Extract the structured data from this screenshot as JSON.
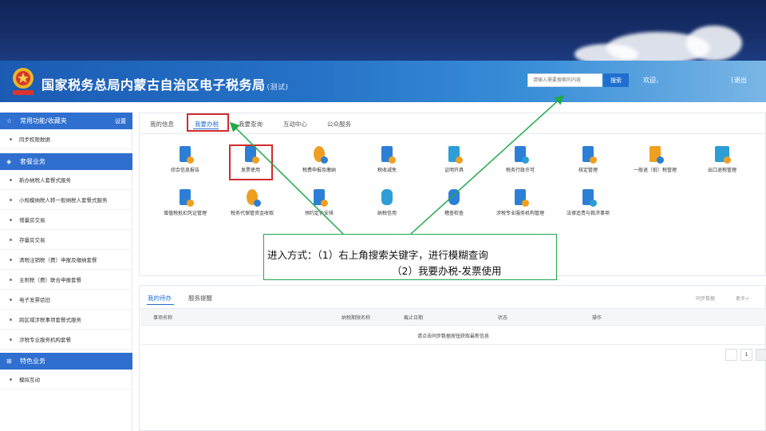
{
  "header": {
    "site_title": "国家税务总局内蒙古自治区电子税务局",
    "site_tag": "(测试)",
    "search_placeholder": "请输入需要搜索的内容",
    "search_button": "搜索",
    "welcome": "欢迎，",
    "separator": "|",
    "logout": "退出"
  },
  "sidebar": {
    "common": {
      "label": "常用功能/收藏夹",
      "setting": "设置"
    },
    "common_items": [
      "同步权限数据"
    ],
    "package": {
      "label": "套餐业务"
    },
    "package_items": [
      "新办纳税人套餐式服务",
      "小规模纳税人转一般纳税人套餐式服务",
      "增量房交易",
      "存量房交易",
      "清税注销税（费）申报及缴纳套餐",
      "主附税（费）联合申报套餐",
      "电子发票验旧",
      "跨区域涉税事项套餐式服务",
      "涉税专业服务机构套餐"
    ],
    "special": {
      "label": "特色业务"
    },
    "special_items": [
      "模拟互动"
    ]
  },
  "tabs": [
    "我的信息",
    "我要办税",
    "我要查询",
    "互动中心",
    "公众服务"
  ],
  "services_row1": [
    {
      "label": "综合信息报告",
      "icon": "report-icon",
      "color": "#2d7fd6"
    },
    {
      "label": "发票使用",
      "icon": "invoice-icon",
      "color": "#2d7fd6"
    },
    {
      "label": "税费申报及缴纳",
      "icon": "tax-declare-icon",
      "color": "#f0a020"
    },
    {
      "label": "税收减免",
      "icon": "tax-relief-icon",
      "color": "#2d7fd6"
    },
    {
      "label": "证明开具",
      "icon": "certificate-icon",
      "color": "#2d9ed6"
    },
    {
      "label": "税务行政许可",
      "icon": "license-icon",
      "color": "#2d7fd6"
    },
    {
      "label": "核定管理",
      "icon": "approval-icon",
      "color": "#2d7fd6"
    },
    {
      "label": "一般退（抵）税管理",
      "icon": "refund-icon",
      "color": "#f0a020"
    },
    {
      "label": "出口退税管理",
      "icon": "export-refund-icon",
      "color": "#2d9ed6"
    }
  ],
  "services_row2": [
    {
      "label": "增值税抵扣凭证管理",
      "icon": "vat-voucher-icon",
      "color": "#2d7fd6"
    },
    {
      "label": "税务代保管资金收取",
      "icon": "custody-fund-icon",
      "color": "#f0a020"
    },
    {
      "label": "预约定价安排",
      "icon": "pricing-icon",
      "color": "#2d7fd6"
    },
    {
      "label": "纳税信用",
      "icon": "credit-icon",
      "color": "#2d9ed6"
    },
    {
      "label": "稽查检查",
      "icon": "inspection-icon",
      "color": "#2d7fd6"
    },
    {
      "label": "涉税专业服务机构管理",
      "icon": "agency-icon",
      "color": "#2d7fd6"
    },
    {
      "label": "法律追责与救济事项",
      "icon": "legal-icon",
      "color": "#2d7fd6"
    }
  ],
  "callout": {
    "line1": "进入方式：（1）右上角搜索关键字，进行模糊查询",
    "line2": "（2）我要办税-发票使用"
  },
  "lower": {
    "tabs": [
      "我的待办",
      "服务提醒"
    ],
    "sync": "同步数据",
    "more": "更多>",
    "columns": [
      "事项名称",
      "纳税期限名称",
      "截止日期",
      "状态",
      "操作"
    ],
    "empty_message": "请点击同步数据按钮获取最新信息",
    "page": "1"
  },
  "colors": {
    "accent": "#1f6fd0",
    "highlight": "#d22b2b",
    "annotation": "#21a94a"
  }
}
